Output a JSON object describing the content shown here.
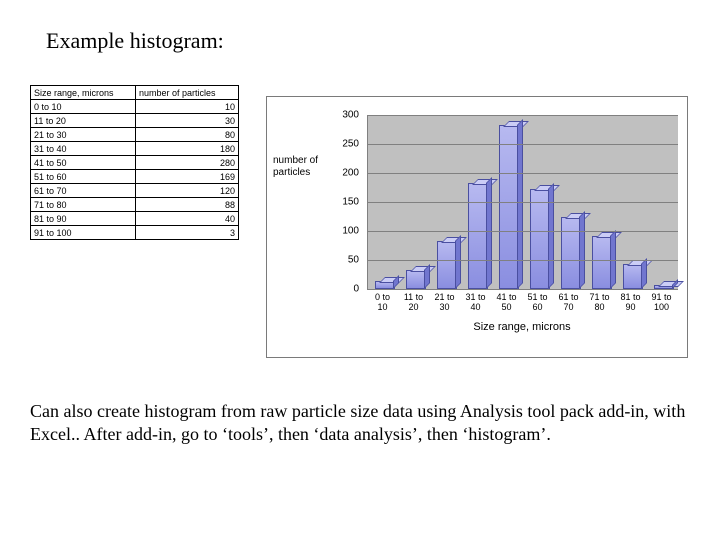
{
  "title": "Example histogram:",
  "table": {
    "headers": [
      "Size range, microns",
      "number of particles"
    ],
    "rows": [
      [
        "0 to 10",
        "10"
      ],
      [
        "11 to 20",
        "30"
      ],
      [
        "21 to 30",
        "80"
      ],
      [
        "31 to 40",
        "180"
      ],
      [
        "41 to 50",
        "280"
      ],
      [
        "51 to 60",
        "169"
      ],
      [
        "61 to 70",
        "120"
      ],
      [
        "71 to 80",
        "88"
      ],
      [
        "81 to 90",
        "40"
      ],
      [
        "91 to 100",
        "3"
      ]
    ]
  },
  "chart_data": {
    "type": "bar",
    "categories": [
      "0 to 10",
      "11 to 20",
      "21 to 30",
      "31 to 40",
      "41 to 50",
      "51 to 60",
      "61 to 70",
      "71 to 80",
      "81 to 90",
      "91 to 100"
    ],
    "values": [
      10,
      30,
      80,
      180,
      280,
      169,
      120,
      88,
      40,
      3
    ],
    "ylabel": "number of particles",
    "xlabel": "Size range, microns",
    "ylim": [
      0,
      300
    ],
    "yticks": [
      0,
      50,
      100,
      150,
      200,
      250,
      300
    ],
    "colors": {
      "bar_fill": "#9498e6",
      "plot_bg": "#c0c0c0"
    }
  },
  "caption": "Can also create histogram from raw particle size data using Analysis tool pack add-in, with Excel..  After add-in, go to ‘tools’, then ‘data analysis’, then ‘histogram’."
}
